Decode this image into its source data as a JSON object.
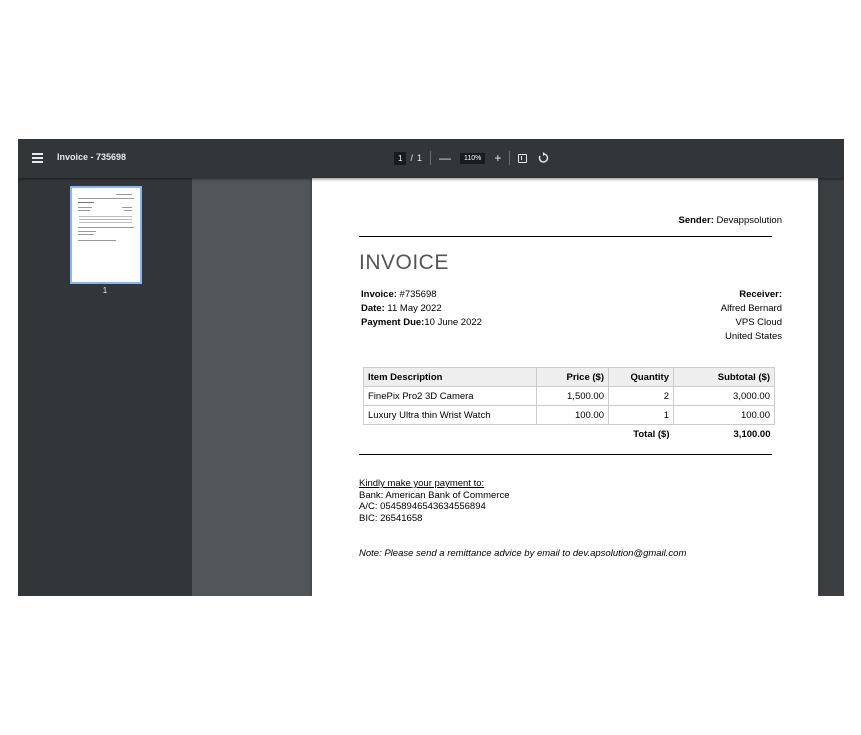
{
  "toolbar": {
    "title": "Invoice - 735698",
    "page_current": "1",
    "page_separator": "/",
    "page_total": "1",
    "zoom_out": "—",
    "zoom": "110%",
    "zoom_in": "+"
  },
  "sidebar": {
    "thumbnail_label": "1"
  },
  "invoice": {
    "sender_label": "Sender:",
    "sender_name": "Devappsolution",
    "title": "INVOICE",
    "invoice_label": "Invoice:",
    "invoice_number": "#735698",
    "date_label": "Date:",
    "date": "11 May 2022",
    "due_label": "Payment Due:",
    "due": "10 June 2022",
    "receiver_label": "Receiver:",
    "receiver_lines": [
      "Alfred Bernard",
      "VPS Cloud",
      "United States"
    ],
    "columns": [
      "Item Description",
      "Price ($)",
      "Quantity",
      "Subtotal ($)"
    ],
    "rows": [
      [
        "FinePix Pro2 3D Camera",
        "1,500.00",
        "2",
        "3,000.00"
      ],
      [
        "Luxury Ultra thin Wrist Watch",
        "100.00",
        "1",
        "100.00"
      ]
    ],
    "total_label": "Total ($)",
    "total_value": "3,100.00",
    "payment_heading": "Kindly make your payment to:",
    "payment_lines": [
      "Bank: American Bank of Commerce",
      "A/C: 05458946543634556894",
      "BIC: 26541658"
    ],
    "note": "Note: Please send a remittance advice by email to dev.apsolution@gmail.com"
  },
  "icons": [
    "menu-icon",
    "fit-to-page-icon",
    "rotate-icon"
  ],
  "colors": {
    "toolbar": "#323639",
    "viewer_bg": "#525659",
    "thumbnail_border": "#8ab4f8"
  }
}
